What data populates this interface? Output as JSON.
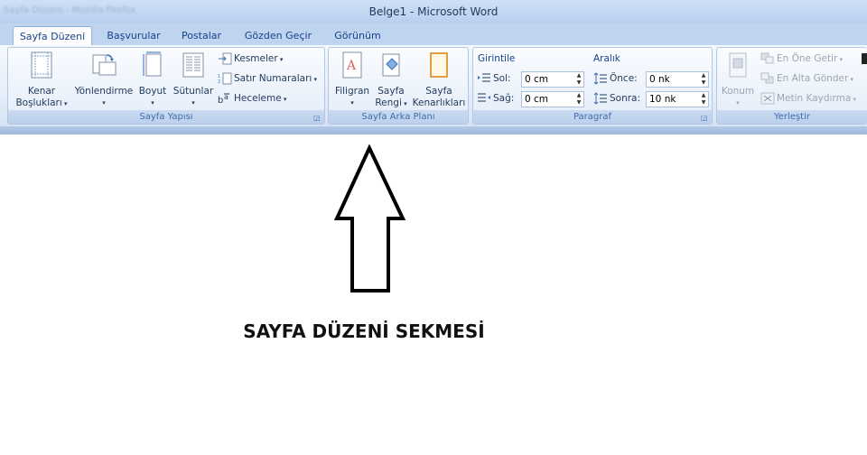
{
  "window": {
    "blurred_left_text": "Sayfa Düzeni - Mozilla Firefox",
    "title": "Belge1 - Microsoft Word"
  },
  "tabs": [
    {
      "label": "Sayfa Düzeni",
      "active": true
    },
    {
      "label": "Başvurular"
    },
    {
      "label": "Postalar"
    },
    {
      "label": "Gözden Geçir"
    },
    {
      "label": "Görünüm"
    }
  ],
  "groups": {
    "sayfa_yapisi": {
      "label": "Sayfa Yapısı",
      "margins_line1": "Kenar",
      "margins_line2": "Boşlukları",
      "orientation": "Yönlendirme",
      "size": "Boyut",
      "columns": "Sütunlar",
      "breaks": "Kesmeler",
      "line_numbers": "Satır Numaraları",
      "hyphenation": "Heceleme"
    },
    "sayfa_arka_plani": {
      "label": "Sayfa Arka Planı",
      "watermark": "Filigran",
      "page_color_line1": "Sayfa",
      "page_color_line2": "Rengi",
      "page_borders_line1": "Sayfa",
      "page_borders_line2": "Kenarlıkları"
    },
    "paragraf": {
      "label": "Paragraf",
      "indent_title": "Girintile",
      "indent_left_label": "Sol:",
      "indent_left_value": "0 cm",
      "indent_right_label": "Sağ:",
      "indent_right_value": "0 cm",
      "spacing_title": "Aralık",
      "spacing_before_label": "Önce:",
      "spacing_before_value": "0 nk",
      "spacing_after_label": "Sonra:",
      "spacing_after_value": "10 nk"
    },
    "yerlestir": {
      "label": "Yerleştir",
      "position": "Konum",
      "bring_front": "En Öne Getir",
      "send_back": "En Alta Gönder",
      "text_wrap": "Metin Kaydırma"
    }
  },
  "caption": "SAYFA DÜZENİ SEKMESİ",
  "colors": {
    "ribbon_text": "#1e395b",
    "tab_text": "#15428b",
    "group_label_text": "#3e6aaa"
  }
}
